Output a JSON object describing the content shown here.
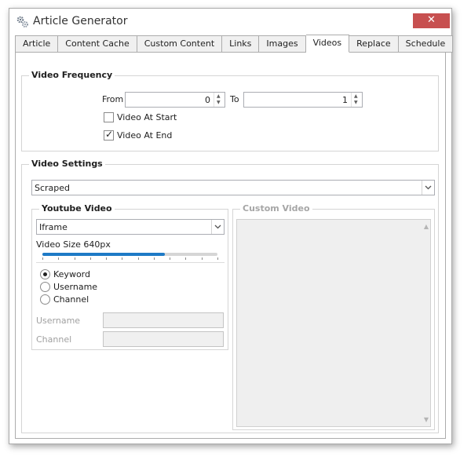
{
  "window": {
    "title": "Article Generator",
    "close_glyph": "✕"
  },
  "tabs": [
    "Article",
    "Content Cache",
    "Custom Content",
    "Links",
    "Images",
    "Videos",
    "Replace",
    "Schedule"
  ],
  "active_tab": "Videos",
  "video_frequency": {
    "title": "Video Frequency",
    "from_label": "From",
    "from_value": "0",
    "to_label": "To",
    "to_value": "1",
    "video_at_start_label": "Video At Start",
    "video_at_start_checked": false,
    "video_at_end_label": "Video At End",
    "video_at_end_checked": true
  },
  "video_settings": {
    "title": "Video Settings",
    "source_value": "Scraped",
    "youtube": {
      "title": "Youtube Video",
      "embed_value": "Iframe",
      "size_label": "Video Size 640px",
      "size_slider_fraction": 0.7,
      "radios": [
        {
          "label": "Keyword",
          "checked": true
        },
        {
          "label": "Username",
          "checked": false
        },
        {
          "label": "Channel",
          "checked": false
        }
      ],
      "username_label": "Username",
      "channel_label": "Channel"
    },
    "custom": {
      "title": "Custom Video"
    }
  },
  "icons": {
    "app": "gears-icon",
    "close": "close-icon",
    "dropdown": "chevron-down-icon",
    "spin": "spin-arrows-icon"
  },
  "colors": {
    "close_button": "#c75050",
    "slider_fill": "#1e7ac6"
  }
}
